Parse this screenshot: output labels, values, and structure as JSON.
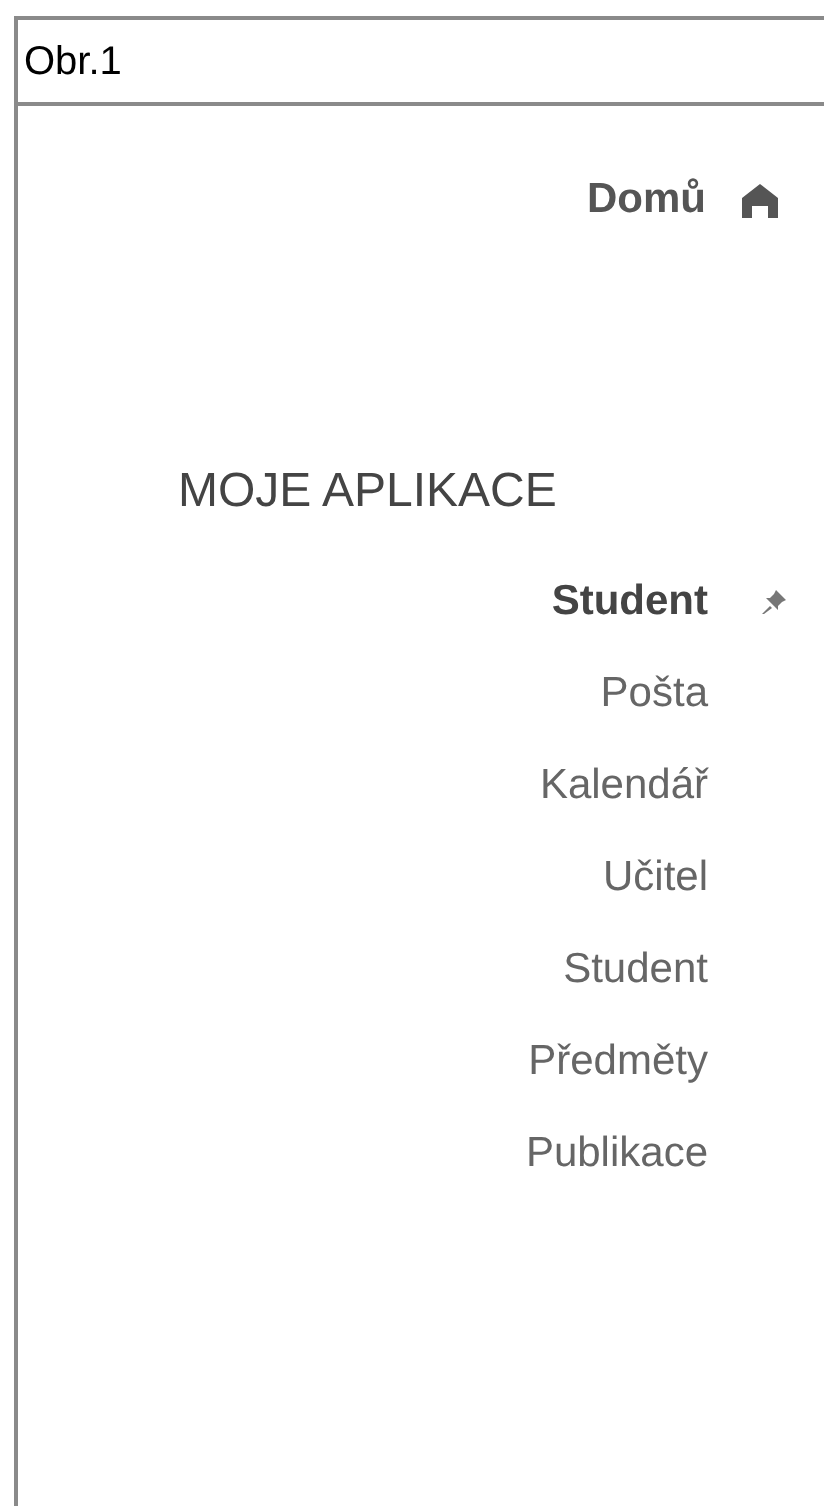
{
  "caption": "Obr.1",
  "home": {
    "label": "Domů"
  },
  "section_title": "MOJE APLIKACE",
  "apps": [
    {
      "label": "Student",
      "selected": true,
      "pinned": true
    },
    {
      "label": "Pošta",
      "selected": false,
      "pinned": false
    },
    {
      "label": "Kalendář",
      "selected": false,
      "pinned": false
    },
    {
      "label": "Učitel",
      "selected": false,
      "pinned": false
    },
    {
      "label": "Student",
      "selected": false,
      "pinned": false
    },
    {
      "label": "Předměty",
      "selected": false,
      "pinned": false
    },
    {
      "label": "Publikace",
      "selected": false,
      "pinned": false
    }
  ]
}
